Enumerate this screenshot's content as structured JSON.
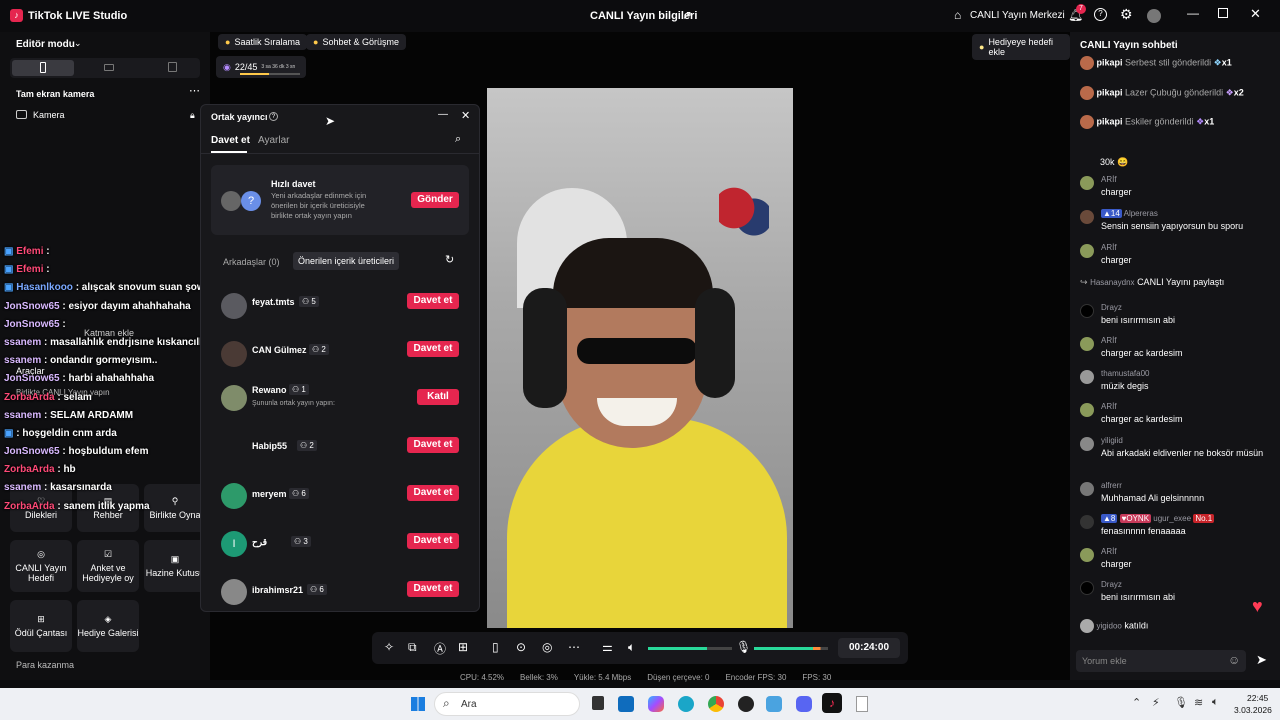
{
  "app": {
    "title": "TikTok LIVE Studio",
    "center_title": "CANLI Yayın bilgileri",
    "live_center": "CANLI Yayın Merkezi",
    "notif_count": "7"
  },
  "left": {
    "editor_mode": "Editör modu",
    "fullscreen_camera": "Tam ekran kamera",
    "camera": "Kamera",
    "add_layer": "Katman ekle",
    "tools": "Araçlar",
    "co_live": "Birlikte CANLI Yayın yapın",
    "earn": "Para kazanma",
    "cards": [
      {
        "label": "Dilekleri"
      },
      {
        "label": "Rehber"
      },
      {
        "label": "Birlikte Oyna"
      },
      {
        "label": "CANLI Yayın Hedefi"
      },
      {
        "label": "Anket ve Hediyeyle oy"
      },
      {
        "label": "Hazine Kutusu"
      },
      {
        "label": "Ödül Çantası"
      },
      {
        "label": "Hediye Galerisi"
      }
    ]
  },
  "stage": {
    "hourly_rank": "Saatlik Sıralama",
    "chat_meet": "Sohbet & Görüşme",
    "gift_goal": "Hediyeye hedefi ekle",
    "progress_text": "22/45",
    "progress_sub": "3 sa 36 dk 3 sn",
    "progress_fraction": 0.49
  },
  "overlay": [
    {
      "name": "Efemi",
      "msg": ":",
      "color": "#ff4a78"
    },
    {
      "name": "Efemi",
      "msg": ":",
      "color": "#ff4a78"
    },
    {
      "name": "Hasanlkooo",
      "msg": ": alışcak snovum suan şowda eğlencede :D",
      "color": "#7aa8ff"
    },
    {
      "name": "JonSnow65",
      "msg": ": esiyor dayım ahahhahaha",
      "color": "#d9b9ff"
    },
    {
      "name": "JonSnow65",
      "msg": ":",
      "color": "#d9b9ff"
    },
    {
      "name": "ssanem",
      "msg": ": masallahlık endrjısıne kıskancılktan oluyorum",
      "color": "#d9b9ff"
    },
    {
      "name": "ssanem",
      "msg": ": ondandır gormeyısım..",
      "color": "#d9b9ff"
    },
    {
      "name": "JonSnow65",
      "msg": ": harbi ahahahhaha",
      "color": "#d9b9ff"
    },
    {
      "name": "ZorbaArda",
      "msg": ": selam",
      "color": "#ff4a78"
    },
    {
      "name": "ssanem",
      "msg": ": SELAM ARDAMM",
      "color": "#d9b9ff"
    },
    {
      "name": "",
      "msg": ": hoşgeldin cnm arda",
      "color": "#ff4a78"
    },
    {
      "name": "JonSnow65",
      "msg": ": hoşbuldum efem",
      "color": "#d9b9ff"
    },
    {
      "name": "ZorbaArda",
      "msg": ": hb",
      "color": "#ff4a78"
    },
    {
      "name": "ssanem",
      "msg": ": kasarsınarda",
      "color": "#d9b9ff"
    },
    {
      "name": "ZorbaArda",
      "msg": ": sanem itlik yapma",
      "color": "#ff4a78"
    }
  ],
  "dialog": {
    "title": "Ortak yayıncı",
    "tab_invite": "Davet et",
    "tab_settings": "Ayarlar",
    "quick_title": "Hızlı davet",
    "quick_desc": "Yeni arkadaşlar edinmek için önerilen bir içerik üreticisiyle birlikte ortak yayın yapın",
    "send": "Gönder",
    "friends_tab": "Arkadaşlar (0)",
    "suggested_tab": "Önerilen içerik üreticileri",
    "hosting_note": "Şununla ortak yayın yapın:",
    "creators": [
      {
        "name": "feyat.tmts",
        "count": "5",
        "action": "Davet et"
      },
      {
        "name": "CAN Gülmez",
        "count": "2",
        "action": "Davet et"
      },
      {
        "name": "Rewano",
        "count": "1",
        "action": "Katıl"
      },
      {
        "name": "Habip55",
        "count": "2",
        "action": "Davet et"
      },
      {
        "name": "meryem",
        "count": "6",
        "action": "Davet et"
      },
      {
        "name": "قرح",
        "count": "3",
        "action": "Davet et"
      },
      {
        "name": "ibrahimsr21",
        "count": "6",
        "action": "Davet et"
      }
    ]
  },
  "controls": {
    "timer": "00:24:00"
  },
  "stats": {
    "cpu": "CPU:  4.52%",
    "memory": "Bellek:  3%",
    "upload": "Yükle:  5.4 Mbps",
    "dropped": "Düşen çerçeve:  0",
    "encoder": "Encoder FPS:  30",
    "fps": "FPS:  30"
  },
  "chat": {
    "title": "CANLI Yayın sohbeti",
    "gifts": [
      {
        "user": "pikapi",
        "text": "Serbest stil gönderildi",
        "count": "x1"
      },
      {
        "user": "pikapi",
        "text": "Lazer Çubuğu gönderildi",
        "count": "x2"
      },
      {
        "user": "pikapi",
        "text": "Eskiler gönderildi",
        "count": "x1"
      }
    ],
    "first_msg": "30k",
    "messages": [
      {
        "user": "ARİf",
        "text": "charger"
      },
      {
        "user": "Alpereras",
        "text": "Sensin sensiin yapıyorsun bu sporu"
      },
      {
        "user": "ARİf",
        "text": "charger"
      },
      {
        "user": "Drayz",
        "text": "beni ısırırmısın abi"
      },
      {
        "user": "ARİf",
        "text": "charger ac kardesim"
      },
      {
        "user": "thamustafa00",
        "text": "müzik degis"
      },
      {
        "user": "ARİf",
        "text": "charger ac kardesim"
      },
      {
        "user": "yiligiid",
        "text": "Abi arkadaki eldivenler ne boksör müsün"
      },
      {
        "user": "alfrerr",
        "text": "Muhhamad Ali gelsinnnnn"
      },
      {
        "user": "ugur_exee",
        "text": "fenasınnnn fenaaaaa"
      },
      {
        "user": "ARİf",
        "text": "charger"
      },
      {
        "user": "Drayz",
        "text": "beni ısırırmısın abi"
      }
    ],
    "share_user": "Hasanaydnx",
    "share_text": "CANLI Yayını paylaştı",
    "join_user": "yigidoo",
    "join_text": "katıldı",
    "input_placeholder": "Yorum ekle"
  },
  "taskbar": {
    "search": "Ara",
    "time": "22:45",
    "date": "3.03.2026"
  }
}
